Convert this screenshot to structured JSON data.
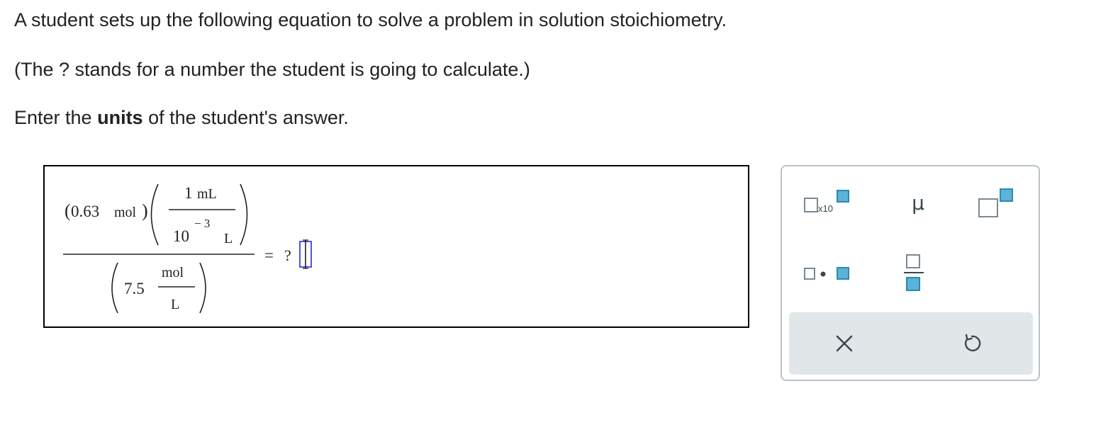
{
  "question": {
    "line1": "A student sets up the following equation to solve a problem in solution stoichiometry.",
    "line2": "(The ? stands for a number the student is going to calculate.)",
    "line3_pre": "Enter the ",
    "line3_bold": "units",
    "line3_post": " of the student's answer."
  },
  "equation": {
    "amount_value": "0.63",
    "amount_unit": "mol",
    "conv_num_value": "1",
    "conv_num_unit": "mL",
    "conv_den_base": "10",
    "conv_den_exp": "− 3",
    "conv_den_unit": "L",
    "conc_value": "7.5",
    "conc_num_unit": "mol",
    "conc_den_unit": "L",
    "equals": "=",
    "unknown": "?"
  },
  "palette": {
    "sci_notation_label": "x10",
    "mu_symbol": "μ",
    "clear_icon": "close-icon",
    "undo_icon": "undo-icon",
    "accent_color": "#5bb3d5",
    "border_color": "#7b8a94"
  }
}
